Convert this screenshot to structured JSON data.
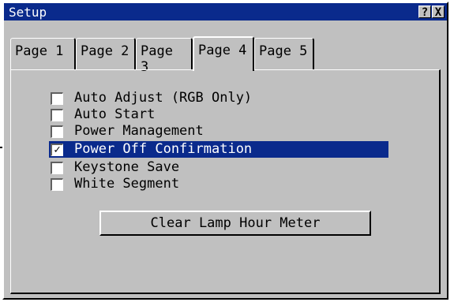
{
  "window": {
    "title": "Setup",
    "help_button": "?",
    "close_button": "X"
  },
  "tabs": [
    {
      "label": "Page 1"
    },
    {
      "label": "Page 2"
    },
    {
      "label": "Page 3"
    },
    {
      "label": "Page 4",
      "active": true
    },
    {
      "label": "Page 5"
    }
  ],
  "options": [
    {
      "label": "Auto Adjust (RGB Only)",
      "checked": false
    },
    {
      "label": "Auto Start",
      "checked": false
    },
    {
      "label": "Power Management",
      "checked": false
    },
    {
      "label": "Power Off Confirmation",
      "checked": true,
      "selected": true
    },
    {
      "label": "Keystone Save",
      "checked": false
    },
    {
      "label": "White Segment",
      "checked": false
    }
  ],
  "buttons": {
    "clear_lamp": "Clear Lamp Hour Meter"
  },
  "colors": {
    "titlebar": "#0a2a8c",
    "face": "#c0c0c0",
    "highlight": "#0a2a8c"
  }
}
